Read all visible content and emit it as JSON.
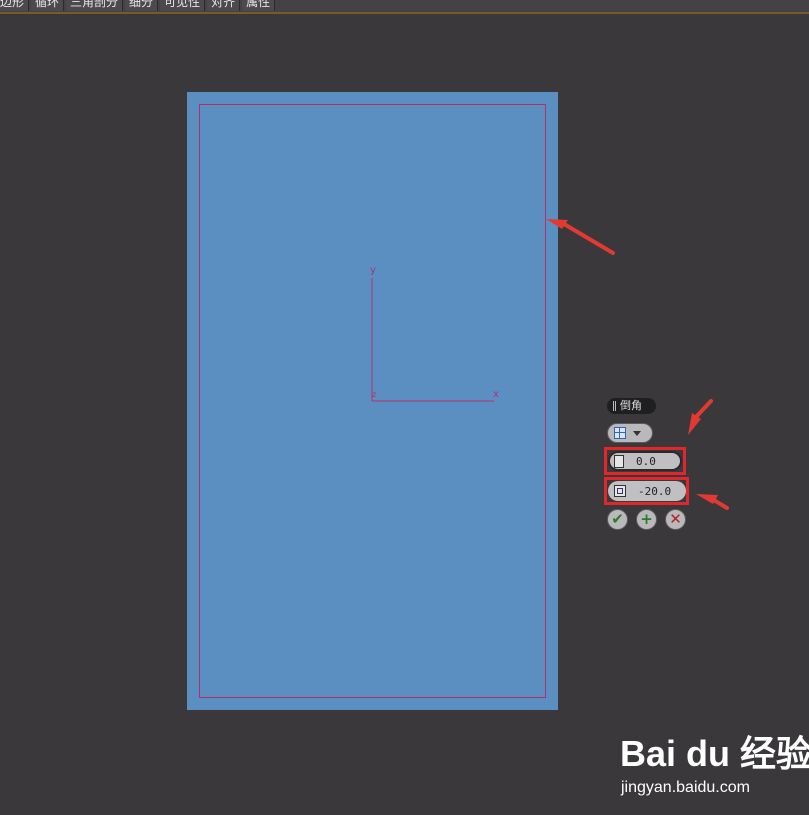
{
  "toolbar": {
    "tabs": [
      "边形",
      "循环",
      "三角剖分",
      "细分",
      "可见性",
      "对齐",
      "属性"
    ]
  },
  "viewport": {
    "axis_y": "y",
    "axis_x": "x",
    "axis_z": "z",
    "colors": {
      "plane": "#5b8fc1",
      "border": "#b3306c",
      "background": "#3a383b"
    }
  },
  "caddy": {
    "title": "倒角",
    "mode_icon": "grid-icon",
    "height_value": "0.0",
    "inset_value": "-20.0",
    "ok_icon": "check-icon",
    "apply_icon": "plus-icon",
    "cancel_icon": "x-icon"
  },
  "watermark": {
    "logo": "Bai du 经验",
    "url": "jingyan.baidu.com"
  }
}
